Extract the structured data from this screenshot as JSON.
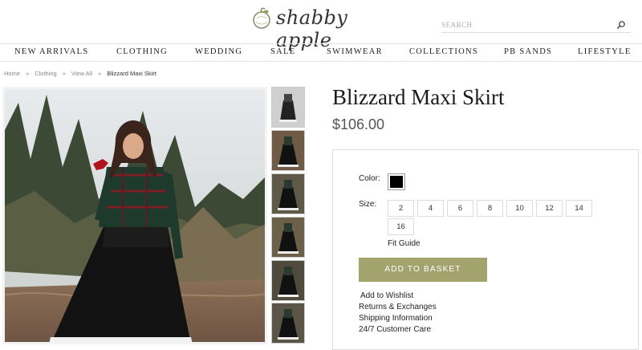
{
  "header": {
    "logo_text": "shabby apple",
    "search": {
      "placeholder": "SEARCH"
    }
  },
  "nav": {
    "items": [
      {
        "label": "NEW ARRIVALS"
      },
      {
        "label": "CLOTHING"
      },
      {
        "label": "WEDDING"
      },
      {
        "label": "SALE"
      },
      {
        "label": "SWIMWEAR"
      },
      {
        "label": "COLLECTIONS"
      },
      {
        "label": "PB SANDS"
      },
      {
        "label": "LIFESTYLE"
      }
    ]
  },
  "breadcrumb": {
    "items": [
      "Home",
      "Clothing",
      "View All",
      "Blizzard Maxi Skirt"
    ],
    "separator": "»"
  },
  "product": {
    "title": "Blizzard Maxi Skirt",
    "price": "$106.00",
    "color_label": "Color:",
    "selected_color": "#000000",
    "size_label": "Size:",
    "sizes": [
      "2",
      "4",
      "6",
      "8",
      "10",
      "12",
      "14",
      "16"
    ],
    "fit_guide": "Fit Guide",
    "add_to_basket": "ADD TO BASKET",
    "button_color": "#a3a36d",
    "links": [
      "Add to Wishlist",
      "Returns & Exchanges",
      "Shipping Information",
      "24/7 Customer Care"
    ]
  },
  "gallery": {
    "thumbnail_count": 6
  }
}
